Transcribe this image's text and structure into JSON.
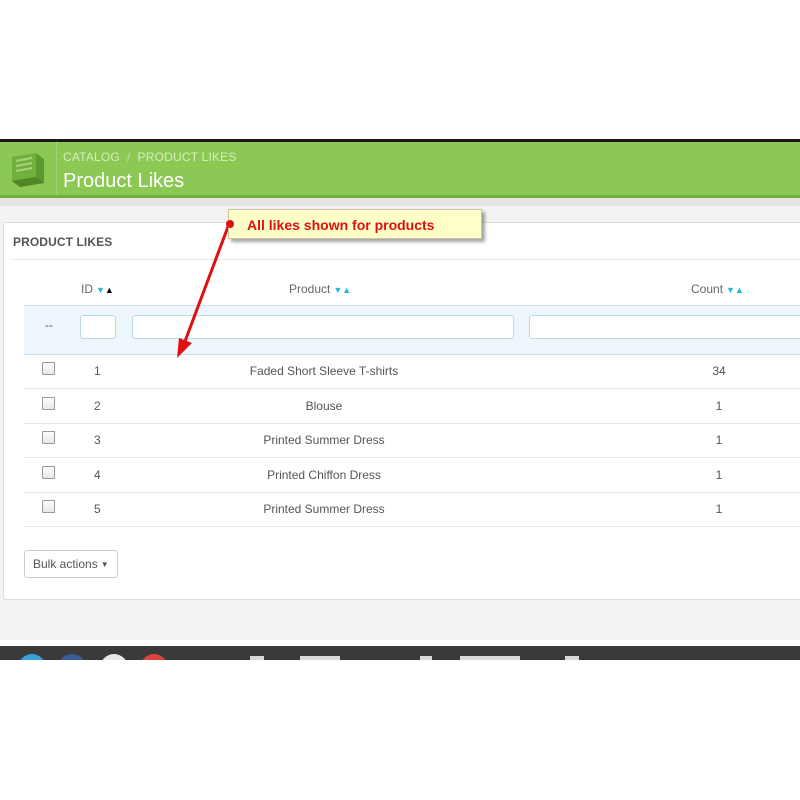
{
  "header": {
    "breadcrumb": [
      "CATALOG",
      "PRODUCT LIKES"
    ],
    "breadcrumb_separator": "/",
    "title": "Product Likes",
    "icon": "book-icon"
  },
  "panel": {
    "heading": "PRODUCT LIKES"
  },
  "table": {
    "columns": [
      {
        "label": "ID",
        "sort": "ascending"
      },
      {
        "label": "Product",
        "sort": "none"
      },
      {
        "label": "Count",
        "sort": "none"
      }
    ],
    "filter_placeholder_dash": "--",
    "rows": [
      {
        "id": "1",
        "product": "Faded Short Sleeve T-shirts",
        "count": "34"
      },
      {
        "id": "2",
        "product": "Blouse",
        "count": "1"
      },
      {
        "id": "3",
        "product": "Printed Summer Dress",
        "count": "1"
      },
      {
        "id": "4",
        "product": "Printed Chiffon Dress",
        "count": "1"
      },
      {
        "id": "5",
        "product": "Printed Summer Dress",
        "count": "1"
      }
    ]
  },
  "bulk_actions": {
    "label": "Bulk actions"
  },
  "annotation": {
    "text": "All likes shown for products"
  },
  "colors": {
    "header_green": "#8bc954",
    "sort_arrow_blue": "#25b9d7",
    "annotation_red": "#e01010",
    "annotation_bg": "#ffffc8"
  }
}
